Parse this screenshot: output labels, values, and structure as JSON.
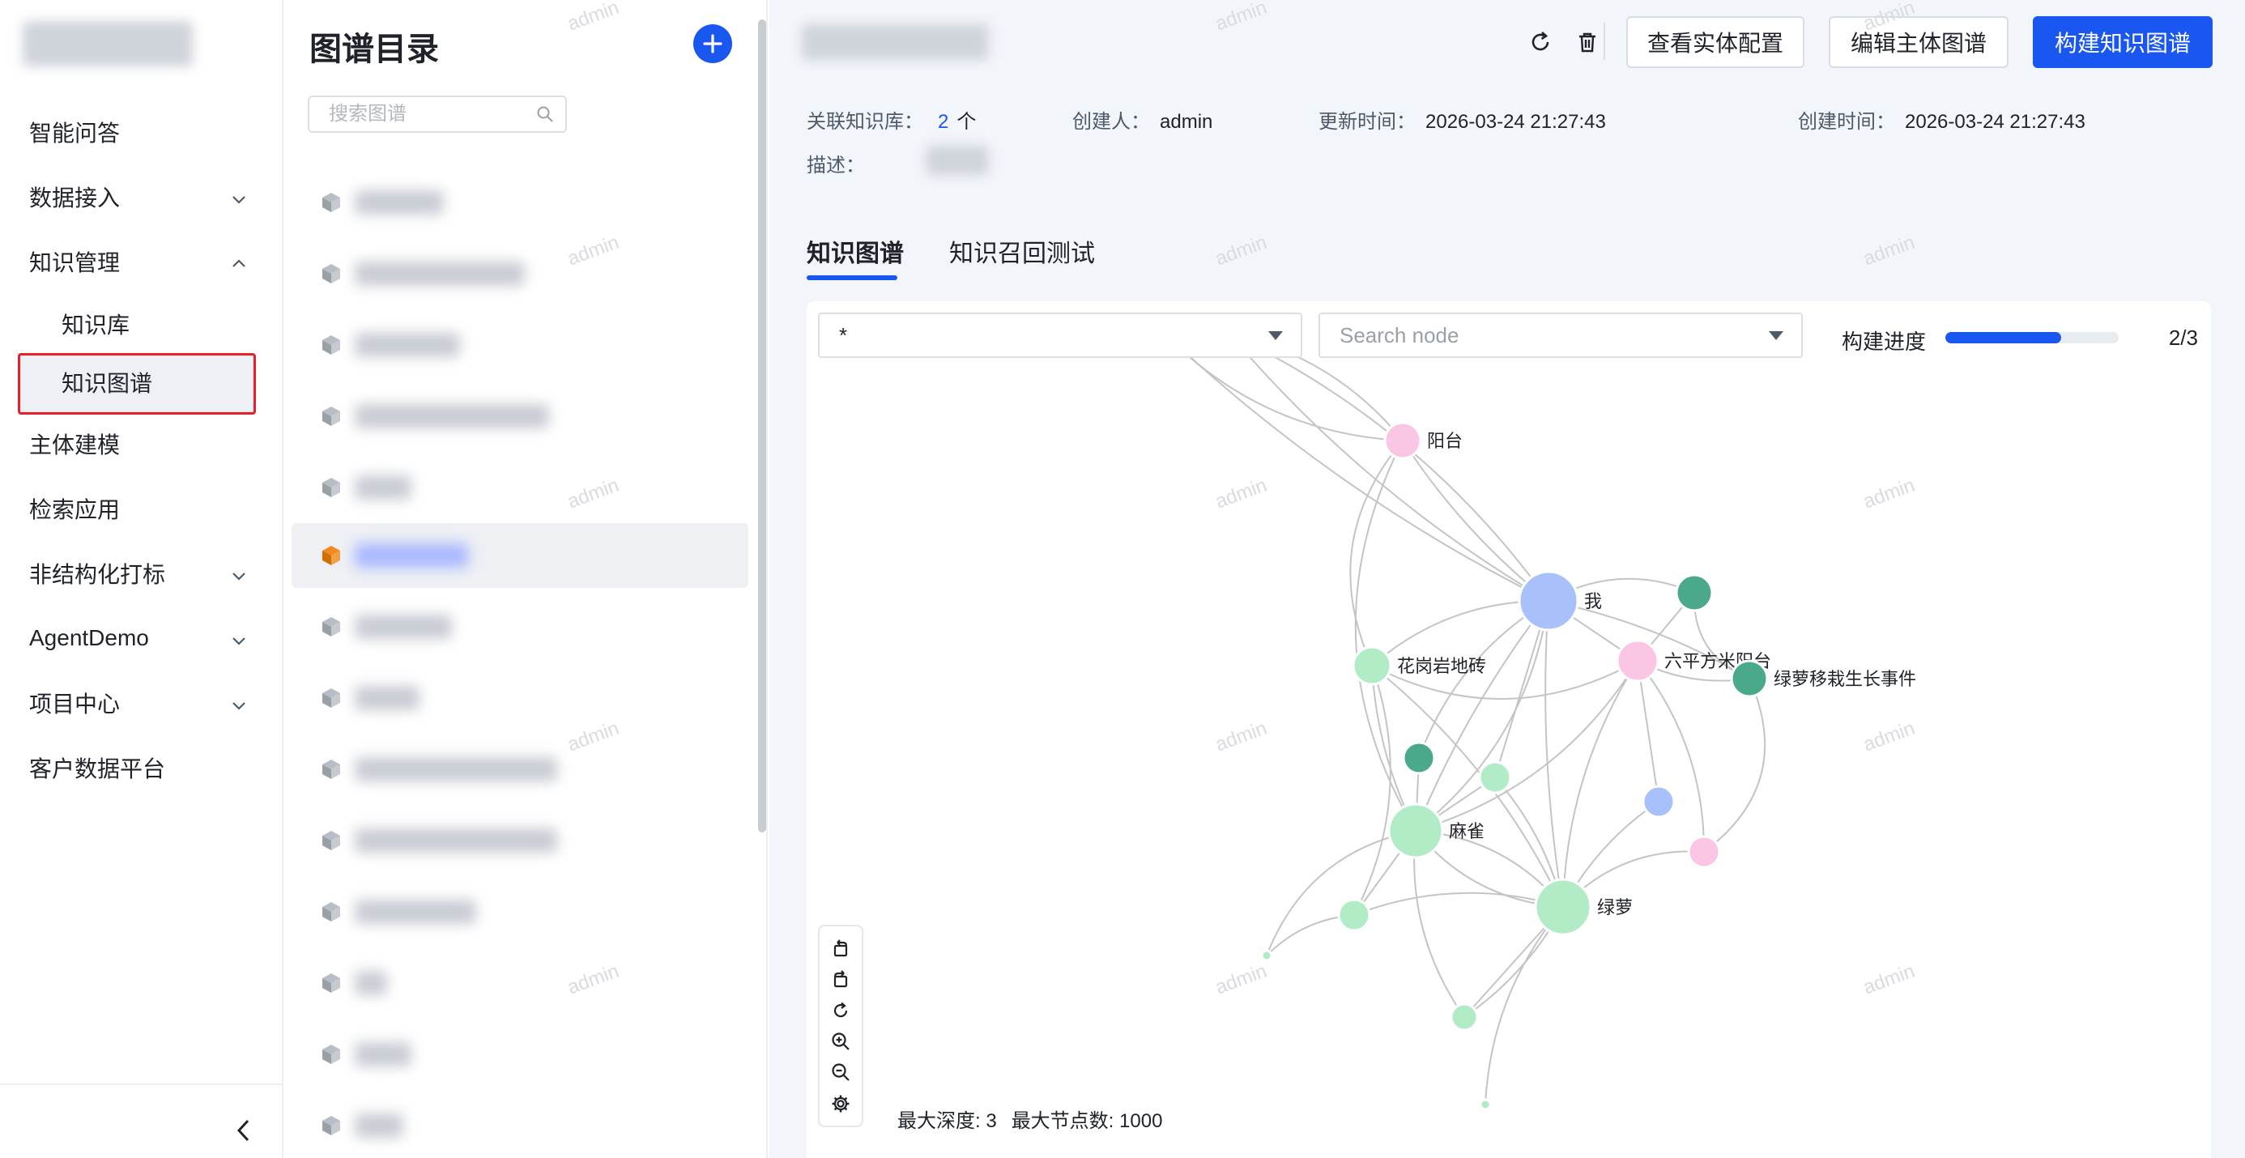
{
  "nav": {
    "items": [
      {
        "label": "智能问答",
        "expandable": false
      },
      {
        "label": "数据接入",
        "expandable": true,
        "expanded": false
      },
      {
        "label": "知识管理",
        "expandable": true,
        "expanded": true
      },
      {
        "label": "知识库",
        "sub": true
      },
      {
        "label": "知识图谱",
        "sub": true,
        "active": true
      },
      {
        "label": "主体建模",
        "expandable": false
      },
      {
        "label": "检索应用",
        "expandable": false
      },
      {
        "label": "非结构化打标",
        "expandable": true,
        "expanded": false
      },
      {
        "label": "AgentDemo",
        "expandable": true,
        "expanded": false
      },
      {
        "label": "项目中心",
        "expandable": true,
        "expanded": false
      },
      {
        "label": "客户数据平台",
        "expandable": false
      }
    ]
  },
  "directory": {
    "title": "图谱目录",
    "search_placeholder": "搜索图谱"
  },
  "detail": {
    "buttons": {
      "view_entity": "查看实体配置",
      "edit_subject": "编辑主体图谱",
      "build": "构建知识图谱"
    },
    "meta": {
      "kb_label": "关联知识库：",
      "kb_count": "2",
      "kb_unit": "个",
      "creator_label": "创建人：",
      "creator": "admin",
      "updated_label": "更新时间：",
      "updated": "2026-03-24 21:27:43",
      "created_label": "创建时间：",
      "created": "2026-03-24 21:27:43",
      "desc_label": "描述："
    },
    "tabs": [
      "知识图谱",
      "知识召回测试"
    ]
  },
  "graph": {
    "type_filter": "*",
    "node_search_placeholder": "Search node",
    "progress_label": "构建进度",
    "progress": {
      "done": 2,
      "total": 3
    },
    "progress_text": "2/3",
    "footer": {
      "max_depth": "最大深度: 3",
      "max_nodes": "最大节点数: 1000"
    },
    "node_labels": [
      "阳台",
      "我",
      "六平方米阳台",
      "绿萝移栽生长事件",
      "花岗岩地砖",
      "麻雀",
      "绿萝"
    ],
    "colors": {
      "person": "#a9c1fb",
      "place": "#fbc6e3",
      "thing": "#b1ecc6",
      "event": "#4aa98b",
      "edge": "#c4c4c4"
    }
  },
  "watermark": "admin"
}
